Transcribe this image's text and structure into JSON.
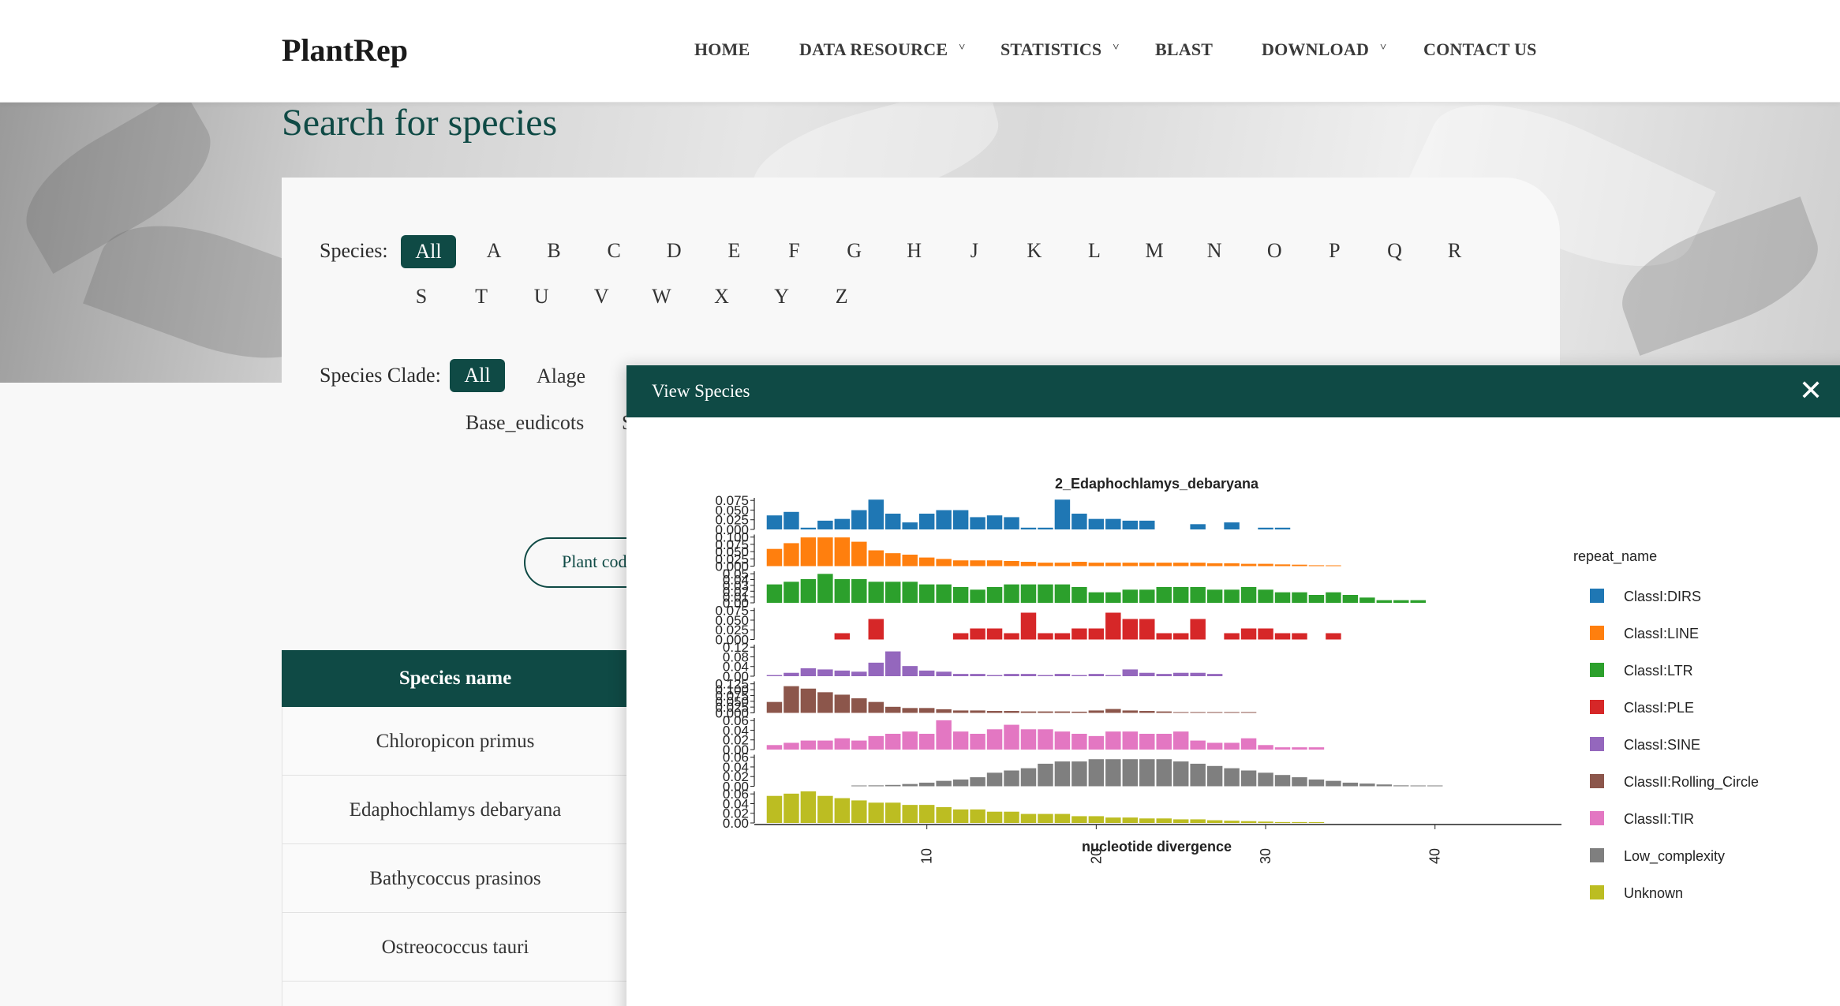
{
  "brand": "PlantRep",
  "nav": [
    {
      "label": "HOME",
      "dropdown": false
    },
    {
      "label": "DATA RESOURCE",
      "dropdown": true
    },
    {
      "label": "STATISTICS",
      "dropdown": true
    },
    {
      "label": "BLAST",
      "dropdown": false
    },
    {
      "label": "DOWNLOAD",
      "dropdown": true
    },
    {
      "label": "CONTACT US",
      "dropdown": false
    }
  ],
  "page_title": "Search for species",
  "species_filter": {
    "label": "Species:",
    "active": "All",
    "letters_row1": [
      "A",
      "B",
      "C",
      "D",
      "E",
      "F",
      "G",
      "H",
      "J",
      "K",
      "L",
      "M",
      "N",
      "O",
      "P",
      "Q",
      "R"
    ],
    "letters_row2": [
      "S",
      "T",
      "U",
      "V",
      "W",
      "X",
      "Y",
      "Z"
    ]
  },
  "clade_filter": {
    "label": "Species Clade:",
    "active": "All",
    "options": [
      "Alage",
      "Base_eudicots"
    ],
    "partial": "S"
  },
  "coding_button": "Plant coding",
  "table": {
    "header": "Species name",
    "rows": [
      "Chloropicon primus",
      "Edaphochlamys debaryana",
      "Bathycoccus prasinos",
      "Ostreococcus tauri"
    ]
  },
  "modal": {
    "title": "View Species",
    "close_icon": "close-icon"
  },
  "colors": {
    "primary": "#0f4a45",
    "series": [
      "#1f77b4",
      "#ff7f0e",
      "#2ca02c",
      "#d62728",
      "#9467bd",
      "#8c564b",
      "#e377c2",
      "#7f7f7f",
      "#bcbd22"
    ]
  },
  "chart_data": {
    "type": "bar",
    "title": "2_Edaphochlamys_debaryana",
    "xlabel": "nucleotide divergence",
    "ylabel": "",
    "legend_title": "repeat_name",
    "legend_position": "right",
    "x_ticks": [
      10,
      20,
      30,
      40
    ],
    "xlim": [
      0,
      47
    ],
    "x": [
      1,
      2,
      3,
      4,
      5,
      6,
      7,
      8,
      9,
      10,
      11,
      12,
      13,
      14,
      15,
      16,
      17,
      18,
      19,
      20,
      21,
      22,
      23,
      24,
      25,
      26,
      27,
      28,
      29,
      30,
      31,
      32,
      33,
      34,
      35,
      36,
      37,
      38,
      39,
      40
    ],
    "series": [
      {
        "name": "ClassI:DIRS",
        "ylim": [
          0,
          0.09
        ],
        "y_ticks": [
          "0.000",
          "0.025",
          "0.050",
          "0.075"
        ],
        "values": [
          0.04,
          0.05,
          0.005,
          0.025,
          0.03,
          0.055,
          0.085,
          0.045,
          0.02,
          0.045,
          0.055,
          0.055,
          0.035,
          0.04,
          0.035,
          0.005,
          0.005,
          0.085,
          0.045,
          0.03,
          0.03,
          0.025,
          0.025,
          0,
          0,
          0.015,
          0,
          0.02,
          0,
          0.005,
          0.005,
          0,
          0,
          0,
          0,
          0,
          0,
          0,
          0,
          0
        ]
      },
      {
        "name": "ClassI:LINE",
        "ylim": [
          0,
          0.11
        ],
        "y_ticks": [
          "0.000",
          "0.025",
          "0.050",
          "0.075",
          "0.100"
        ],
        "values": [
          0.06,
          0.08,
          0.1,
          0.1,
          0.1,
          0.085,
          0.055,
          0.045,
          0.04,
          0.03,
          0.025,
          0.02,
          0.02,
          0.02,
          0.018,
          0.015,
          0.012,
          0.012,
          0.015,
          0.012,
          0.012,
          0.012,
          0.012,
          0.012,
          0.012,
          0.012,
          0.01,
          0.01,
          0.008,
          0.008,
          0.006,
          0.005,
          0.003,
          0.002,
          0,
          0,
          0,
          0,
          0,
          0
        ]
      },
      {
        "name": "ClassI:LTR",
        "ylim": [
          0,
          0.06
        ],
        "y_ticks": [
          "0.00",
          "0.01",
          "0.02",
          "0.03",
          "0.04",
          "0.05"
        ],
        "values": [
          0.035,
          0.04,
          0.045,
          0.055,
          0.045,
          0.045,
          0.04,
          0.04,
          0.04,
          0.035,
          0.035,
          0.03,
          0.025,
          0.03,
          0.035,
          0.035,
          0.035,
          0.035,
          0.03,
          0.02,
          0.02,
          0.025,
          0.025,
          0.03,
          0.03,
          0.03,
          0.025,
          0.025,
          0.03,
          0.025,
          0.02,
          0.02,
          0.015,
          0.02,
          0.015,
          0.01,
          0.005,
          0.005,
          0.005,
          0
        ]
      },
      {
        "name": "ClassI:PLE",
        "ylim": [
          0,
          0.1
        ],
        "y_ticks": [
          "0.000",
          "0.025",
          "0.050",
          "0.075"
        ],
        "values": [
          0,
          0,
          0,
          0,
          0.02,
          0,
          0.065,
          0,
          0,
          0,
          0,
          0.02,
          0.035,
          0.035,
          0.02,
          0.085,
          0.02,
          0.02,
          0.035,
          0.035,
          0.085,
          0.065,
          0.065,
          0.02,
          0.02,
          0.065,
          0,
          0.02,
          0.035,
          0.035,
          0.02,
          0.02,
          0,
          0.02,
          0,
          0,
          0,
          0,
          0,
          0
        ]
      },
      {
        "name": "ClassI:SINE",
        "ylim": [
          0,
          0.14
        ],
        "y_ticks": [
          "0.00",
          "0.04",
          "0.08",
          "0.12"
        ],
        "values": [
          0.005,
          0.015,
          0.035,
          0.03,
          0.025,
          0.02,
          0.06,
          0.11,
          0.045,
          0.025,
          0.02,
          0.01,
          0.01,
          0.005,
          0.01,
          0.01,
          0.005,
          0.01,
          0.005,
          0.01,
          0.005,
          0.03,
          0.015,
          0.01,
          0.015,
          0.015,
          0.01,
          0,
          0,
          0,
          0,
          0,
          0,
          0,
          0,
          0,
          0,
          0,
          0,
          0
        ]
      },
      {
        "name": "ClassII:Rolling_Circle",
        "ylim": [
          0,
          0.13
        ],
        "y_ticks": [
          "0.000",
          "0.025",
          "0.050",
          "0.075",
          "0.100",
          "0.125"
        ],
        "values": [
          0.045,
          0.11,
          0.1,
          0.085,
          0.075,
          0.06,
          0.045,
          0.025,
          0.02,
          0.02,
          0.015,
          0.01,
          0.01,
          0.008,
          0.008,
          0.006,
          0.006,
          0.006,
          0.005,
          0.01,
          0.016,
          0.01,
          0.008,
          0.006,
          0.003,
          0.002,
          0.002,
          0.001,
          0.001,
          0,
          0,
          0,
          0,
          0,
          0,
          0,
          0,
          0,
          0,
          0
        ]
      },
      {
        "name": "ClassII:TIR",
        "ylim": [
          0,
          0.07
        ],
        "y_ticks": [
          "0.00",
          "0.02",
          "0.04",
          "0.06"
        ],
        "values": [
          0.01,
          0.015,
          0.02,
          0.02,
          0.025,
          0.02,
          0.03,
          0.035,
          0.04,
          0.035,
          0.065,
          0.04,
          0.035,
          0.045,
          0.055,
          0.045,
          0.045,
          0.04,
          0.035,
          0.03,
          0.04,
          0.04,
          0.035,
          0.035,
          0.04,
          0.02,
          0.015,
          0.015,
          0.025,
          0.01,
          0.005,
          0.005,
          0.005,
          0,
          0,
          0,
          0,
          0,
          0,
          0
        ]
      },
      {
        "name": "Low_complexity",
        "ylim": [
          0,
          0.07
        ],
        "y_ticks": [
          "0.00",
          "0.02",
          "0.04",
          "0.06"
        ],
        "values": [
          0,
          0,
          0,
          0,
          0,
          0.001,
          0.002,
          0.003,
          0.005,
          0.008,
          0.012,
          0.015,
          0.02,
          0.03,
          0.035,
          0.04,
          0.05,
          0.055,
          0.055,
          0.06,
          0.06,
          0.06,
          0.06,
          0.06,
          0.055,
          0.05,
          0.045,
          0.04,
          0.035,
          0.03,
          0.025,
          0.02,
          0.015,
          0.012,
          0.008,
          0.006,
          0.004,
          0.002,
          0.001,
          0.001
        ]
      },
      {
        "name": "Unknown",
        "ylim": [
          0,
          0.07
        ],
        "y_ticks": [
          "0.00",
          "0.02",
          "0.04",
          "0.06"
        ],
        "values": [
          0.06,
          0.065,
          0.07,
          0.06,
          0.055,
          0.05,
          0.045,
          0.045,
          0.04,
          0.04,
          0.035,
          0.03,
          0.03,
          0.025,
          0.025,
          0.02,
          0.02,
          0.02,
          0.015,
          0.015,
          0.012,
          0.012,
          0.01,
          0.01,
          0.008,
          0.008,
          0.006,
          0.005,
          0.004,
          0.003,
          0.002,
          0.002,
          0.001,
          0,
          0,
          0,
          0,
          0,
          0,
          0
        ]
      }
    ]
  }
}
